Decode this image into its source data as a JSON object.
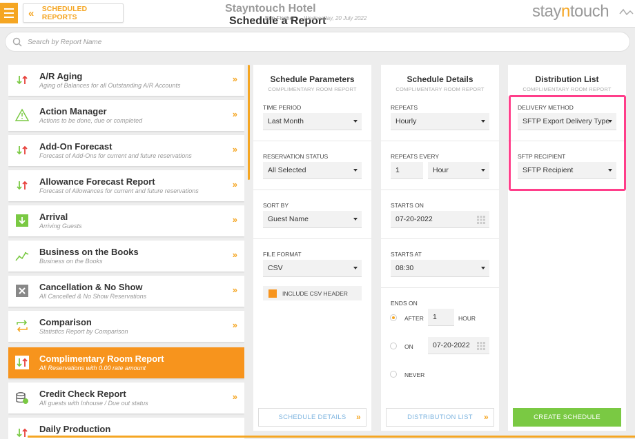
{
  "header": {
    "back_label": "SCHEDULED REPORTS",
    "hotel_name": "Stayntouch Hotel",
    "page_title": "Schedule a Report",
    "user_name": "Erin Fischer",
    "date": "Wednesday, 20 July 2022",
    "logo_part1": "stay",
    "logo_part2": "n",
    "logo_part3": "touch"
  },
  "search": {
    "placeholder": "Search by Report Name"
  },
  "reports": [
    {
      "name": "A/R Aging",
      "desc": "Aging of Balances for all Outstanding A/R Accounts",
      "icon": "up-down-arrows-icon"
    },
    {
      "name": "Action Manager",
      "desc": "Actions to be done, due or completed",
      "icon": "warning-triangle-icon"
    },
    {
      "name": "Add-On Forecast",
      "desc": "Forecast of Add-Ons for current and future reservations",
      "icon": "up-down-arrows-icon"
    },
    {
      "name": "Allowance Forecast Report",
      "desc": "Forecast of Allowances for current and future reservations",
      "icon": "up-down-arrows-icon"
    },
    {
      "name": "Arrival",
      "desc": "Arriving Guests",
      "icon": "arrival-down-arrow-icon"
    },
    {
      "name": "Business on the Books",
      "desc": "Business on the Books",
      "icon": "trend-chart-icon"
    },
    {
      "name": "Cancellation & No Show",
      "desc": "All Cancelled & No Show Reservations",
      "icon": "cancel-x-icon"
    },
    {
      "name": "Comparison",
      "desc": "Statistics Report by Comparison",
      "icon": "compare-arrows-icon"
    },
    {
      "name": "Complimentary Room Report",
      "desc": "All Reservations with 0.00 rate amount",
      "icon": "up-down-arrows-icon"
    },
    {
      "name": "Credit Check Report",
      "desc": "All guests with Inhouse / Due out status",
      "icon": "coins-icon"
    },
    {
      "name": "Daily Production",
      "desc": "",
      "icon": "up-down-arrows-icon"
    }
  ],
  "params": {
    "title": "Schedule Parameters",
    "subtitle": "COMPLIMENTARY ROOM REPORT",
    "time_period_label": "TIME PERIOD",
    "time_period_value": "Last Month",
    "res_status_label": "RESERVATION STATUS",
    "res_status_value": "All Selected",
    "sort_by_label": "SORT BY",
    "sort_by_value": "Guest Name",
    "file_format_label": "FILE FORMAT",
    "file_format_value": "CSV",
    "csv_header_label": "INCLUDE CSV HEADER",
    "footer_button": "SCHEDULE DETAILS"
  },
  "details": {
    "title": "Schedule Details",
    "subtitle": "COMPLIMENTARY ROOM REPORT",
    "repeats_label": "REPEATS",
    "repeats_value": "Hourly",
    "repeats_every_label": "REPEATS EVERY",
    "repeats_every_value": "1",
    "repeats_every_unit": "Hour",
    "starts_on_label": "STARTS ON",
    "starts_on_value": "07-20-2022",
    "starts_at_label": "STARTS AT",
    "starts_at_value": "08:30",
    "ends_on_label": "ENDS ON",
    "after_label": "AFTER",
    "after_value": "1",
    "after_unit": "HOUR",
    "on_label": "ON",
    "on_value": "07-20-2022",
    "never_label": "NEVER",
    "footer_button": "DISTRIBUTION LIST"
  },
  "distribution": {
    "title": "Distribution List",
    "subtitle": "COMPLIMENTARY ROOM REPORT",
    "delivery_method_label": "DELIVERY METHOD",
    "delivery_method_value": "SFTP Export Delivery Type",
    "sftp_recipient_label": "SFTP RECIPIENT",
    "sftp_recipient_value": "SFTP Recipient",
    "create_button": "CREATE SCHEDULE"
  },
  "colors": {
    "accent": "#f5a623",
    "active": "#f7941d",
    "create": "#7ac943",
    "highlight": "#ff3e8a",
    "link": "#7fb5e0"
  }
}
